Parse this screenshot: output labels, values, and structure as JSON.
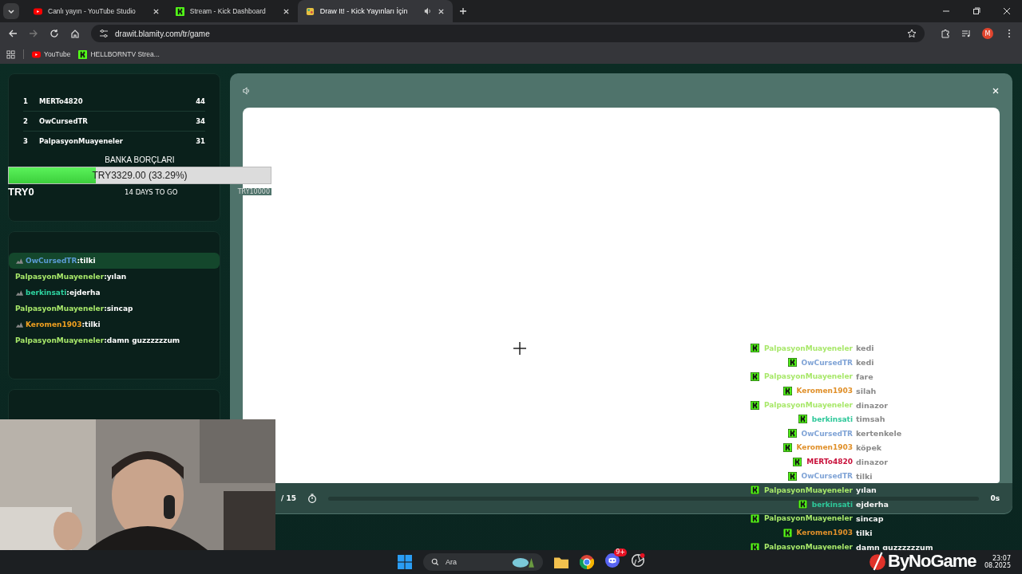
{
  "browser": {
    "tabs": [
      {
        "title": "Canlı yayın - YouTube Studio",
        "selected": false
      },
      {
        "title": "Stream - Kick Dashboard",
        "selected": false
      },
      {
        "title": "Draw It! - Kick Yayınları İçin",
        "selected": true
      }
    ],
    "url": "drawit.blamity.com/tr/game",
    "bookmarks": [
      {
        "label": "YouTube"
      },
      {
        "label": "HELLBORNTV Strea..."
      }
    ],
    "profile": "M"
  },
  "leaderboard": [
    {
      "rank": "1",
      "name": "MERTo4820",
      "score": "44"
    },
    {
      "rank": "2",
      "name": "OwCursedTR",
      "score": "34"
    },
    {
      "rank": "3",
      "name": "PalpasyonMuayeneler",
      "score": "31"
    }
  ],
  "goal": {
    "title": "BANKA BORÇLARI",
    "amount": "TRY3329.00 (33.29%)",
    "level": 0.3329,
    "start": "TRY0",
    "remaining": "14 DAYS TO GO",
    "end": "TRY10000"
  },
  "chat": [
    {
      "name": "OwCursedTR",
      "text": ":tilki",
      "color": "#5b9bd5",
      "badge": true,
      "selected": true
    },
    {
      "name": "PalpasyonMuayeneler",
      "text": ":yılan",
      "color": "#a8e86a",
      "badge": false,
      "selected": false
    },
    {
      "name": "berkinsati",
      "text": ":ejderha",
      "color": "#2ed3a0",
      "badge": true,
      "selected": false
    },
    {
      "name": "PalpasyonMuayeneler",
      "text": ":sincap",
      "color": "#a8e86a",
      "badge": false,
      "selected": false
    },
    {
      "name": "Keromen1903",
      "text": ":tilki",
      "color": "#f0a020",
      "badge": true,
      "selected": false
    },
    {
      "name": "PalpasyonMuayeneler",
      "text": ":damn guzzzzzzum",
      "color": "#a8e86a",
      "badge": false,
      "selected": false
    }
  ],
  "round": {
    "counter": "/ 15",
    "time": "0s"
  },
  "overlay_chat": [
    {
      "name": "PalpasyonMuayeneler",
      "text": "kedi",
      "color": "#a8e86a"
    },
    {
      "name": "OwCursedTR",
      "text": "kedi",
      "color": "#7fa3d6"
    },
    {
      "name": "PalpasyonMuayeneler",
      "text": "fare",
      "color": "#a8e86a"
    },
    {
      "name": "Keromen1903",
      "text": "silah",
      "color": "#e0902a"
    },
    {
      "name": "PalpasyonMuayeneler",
      "text": "dinazor",
      "color": "#a8e86a"
    },
    {
      "name": "berkinsati",
      "text": "timsah",
      "color": "#2ec89a"
    },
    {
      "name": "OwCursedTR",
      "text": "kertenkele",
      "color": "#7fa3d6"
    },
    {
      "name": "Keromen1903",
      "text": "köpek",
      "color": "#e0902a"
    },
    {
      "name": "MERTo4820",
      "text": "dinazor",
      "color": "#c8103a"
    },
    {
      "name": "OwCursedTR",
      "text": "tilki",
      "color": "#7fa3d6"
    },
    {
      "name": "PalpasyonMuayeneler",
      "text": "yılan",
      "color": "#a8e86a"
    },
    {
      "name": "berkinsati",
      "text": "ejderha",
      "color": "#2ec89a"
    },
    {
      "name": "PalpasyonMuayeneler",
      "text": "sincap",
      "color": "#a8e86a"
    },
    {
      "name": "Keromen1903",
      "text": "tilki",
      "color": "#e0902a"
    },
    {
      "name": "PalpasyonMuayeneler",
      "text": "damn guzzzzzzum",
      "color": "#a8e86a"
    }
  ],
  "taskbar": {
    "search": "Ara",
    "discord_badge": "9+",
    "time": "23:07",
    "date": "08.2025"
  },
  "logo": "ByNoGame"
}
